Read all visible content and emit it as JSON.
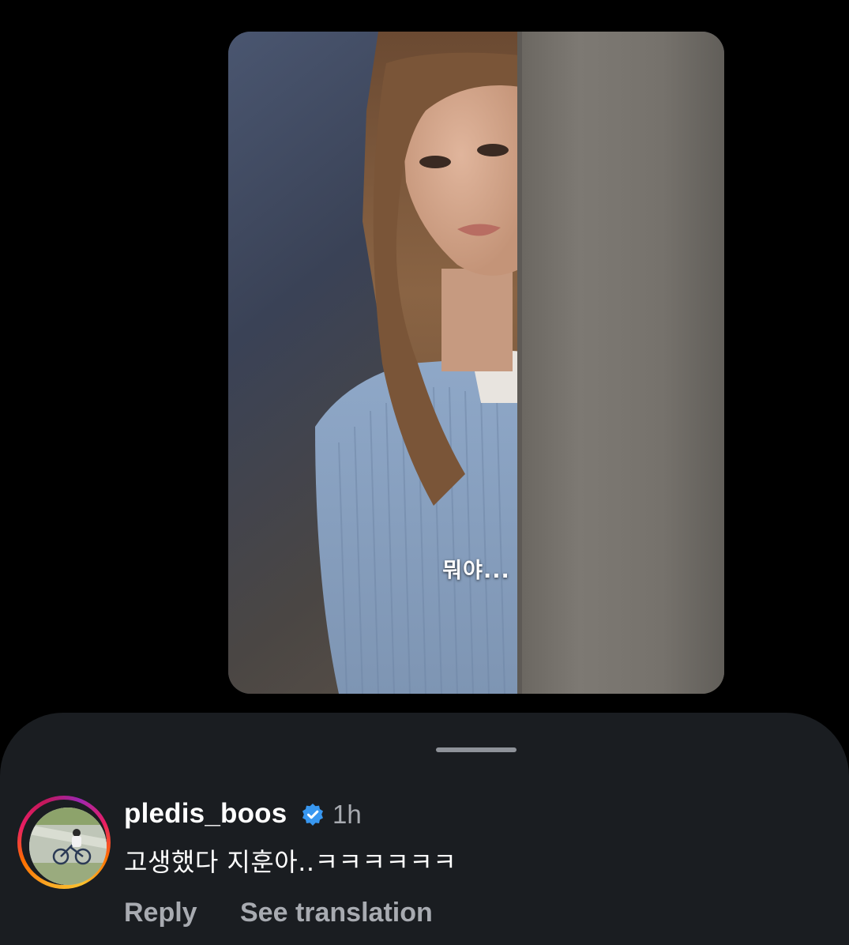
{
  "media": {
    "caption": "뭐야...",
    "description_icon": "photo-media"
  },
  "comment": {
    "username": "pledis_boos",
    "verified": true,
    "time": "1h",
    "text": "고생했다 지훈아..ㅋㅋㅋㅋㅋㅋ",
    "reply_label": "Reply",
    "translate_label": "See translation"
  },
  "colors": {
    "sheet_background": "#1a1d21",
    "secondary_text": "#a8abb1",
    "verified_badge": "#3897f0"
  }
}
